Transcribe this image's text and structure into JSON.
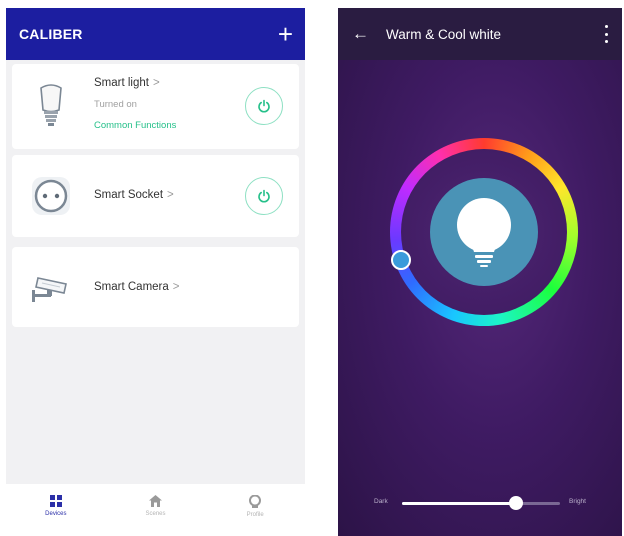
{
  "devices_screen": {
    "app_bar": {
      "brand": "CALIBER",
      "add_icon": "plus-icon"
    },
    "devices": [
      {
        "name": "Smart light",
        "chevron": ">",
        "status": "Turned on",
        "link": "Common Functions",
        "icon": "smart-bulb-icon",
        "has_power": true
      },
      {
        "name": "Smart Socket",
        "chevron": ">",
        "icon": "smart-socket-icon",
        "has_power": true
      },
      {
        "name": "Smart Camera",
        "chevron": ">",
        "icon": "security-camera-icon",
        "has_power": false
      }
    ],
    "power_color": "#26c08a",
    "accent": "#1c1ea0",
    "bottom_nav": [
      {
        "label": "Devices",
        "icon": "grid-icon",
        "active": true
      },
      {
        "label": "Scenes",
        "icon": "home-icon",
        "active": false
      },
      {
        "label": "Profile",
        "icon": "user-icon",
        "active": false
      }
    ]
  },
  "light_screen": {
    "title": "Warm & Cool white",
    "back_icon": "back-arrow-icon",
    "menu_icon": "more-vertical-icon",
    "bulb_icon": "bulb-icon",
    "color_wheel": "rainbow",
    "brightness": {
      "min_label": "Dark",
      "max_label": "Bright",
      "value": 0.72
    }
  }
}
